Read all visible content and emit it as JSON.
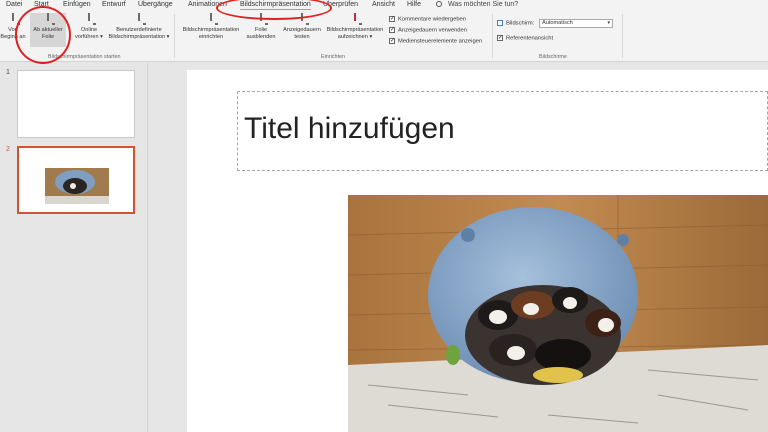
{
  "menu": {
    "tabs": [
      "Datei",
      "Start",
      "Einfügen",
      "Entwurf",
      "Übergänge",
      "Animationen",
      "Bildschirmpräsentation",
      "Überprüfen",
      "Ansicht",
      "Hilfe"
    ],
    "search_placeholder": "Was möchten Sie tun?"
  },
  "ribbon": {
    "start_group": {
      "from_start_l1": "Von",
      "from_start_l2": "Beginn an",
      "from_current_l1": "Ab aktueller",
      "from_current_l2": "Folie",
      "online_l1": "Online",
      "online_l2": "vorführen",
      "custom_l1": "Benutzerdefinierte",
      "custom_l2": "Bildschirmpräsentation",
      "label": "Bildschirmpräsentation starten"
    },
    "setup_group": {
      "setup_l1": "Bildschirmpräsentation",
      "setup_l2": "einrichten",
      "hide_l1": "Folie",
      "hide_l2": "ausblenden",
      "timings_l1": "Anzeigedauern",
      "timings_l2": "testen",
      "record_l1": "Bildschirmpräsentation",
      "record_l2": "aufzeichnen",
      "checkbox_comments": "Kommentare wiedergeben",
      "checkbox_timings": "Anzeigedauern verwenden",
      "checkbox_media": "Mediensteuerelemente anzeigen",
      "label": "Einrichten"
    },
    "monitors_group": {
      "screen_label": "Bildschirm:",
      "screen_value": "Automatisch",
      "presenter_view": "Referentenansicht",
      "label": "Bildschirme"
    }
  },
  "slides": {
    "numbers": [
      "1",
      "2"
    ],
    "selected": "2"
  },
  "slide": {
    "title_placeholder": "Titel hinzufügen"
  },
  "colors": {
    "annotation": "#e02020",
    "selection": "#d35230"
  }
}
